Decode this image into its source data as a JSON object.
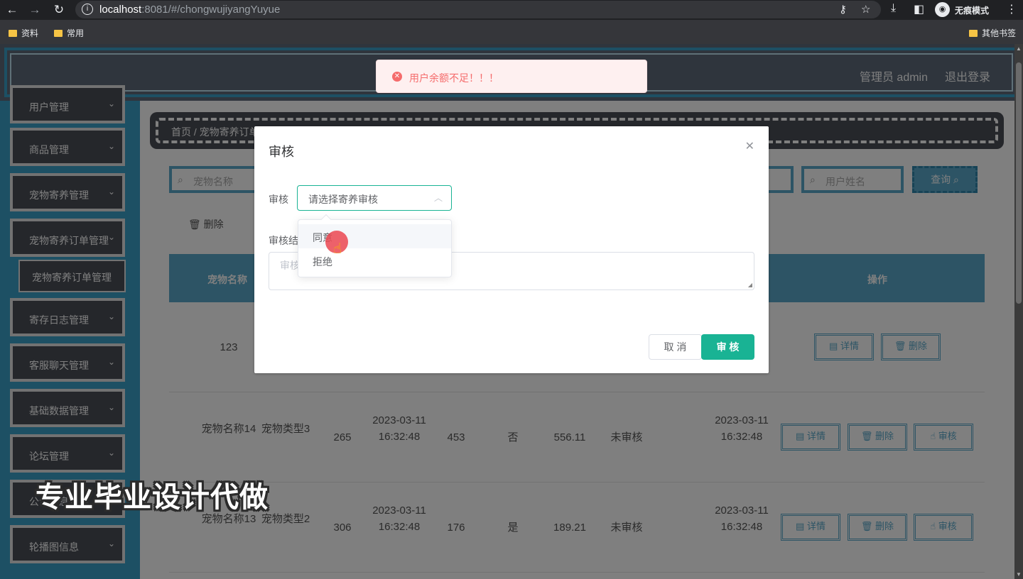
{
  "browser": {
    "url_host": "localhost",
    "url_rest": ":8081/#/chongwujiyangYuyue",
    "incognito_label": "无痕模式",
    "bookmarks": [
      "资料",
      "常用"
    ],
    "other_bookmarks": "其他书签"
  },
  "header": {
    "user_label": "管理员 admin",
    "logout_label": "退出登录"
  },
  "sidebar": {
    "items": [
      {
        "label": "用户管理"
      },
      {
        "label": "商品管理"
      },
      {
        "label": "宠物寄养管理"
      },
      {
        "label": "宠物寄养订单管理"
      },
      {
        "label": "寄存日志管理"
      },
      {
        "label": "客服聊天管理"
      },
      {
        "label": "基础数据管理"
      },
      {
        "label": "论坛管理"
      },
      {
        "label": "公告信息管理"
      },
      {
        "label": "轮播图信息"
      }
    ],
    "sub_item": "宠物寄养订单管理"
  },
  "breadcrumb": {
    "home": "首页",
    "separator": "/",
    "current": "宠物寄养订单管理"
  },
  "search": {
    "pet_name_placeholder": "宠物名称",
    "user_name_placeholder": "用户姓名",
    "query_label": "查询"
  },
  "toolbar": {
    "delete_label": "删除"
  },
  "table": {
    "headers": {
      "pet_name": "宠物名称",
      "actions": "操作"
    },
    "rows": [
      {
        "pet_name": "123",
        "actions": [
          "详情",
          "删除"
        ]
      },
      {
        "pet_name": "宠物名称14",
        "pet_type": "宠物类型3",
        "c3": "265",
        "time1": "2023-03-11 16:32:48",
        "c5": "453",
        "c6": "否",
        "price": "556.11",
        "status": "未审核",
        "time2": "2023-03-11 16:32:48",
        "actions": [
          "详情",
          "删除",
          "审核"
        ]
      },
      {
        "pet_name": "宠物名称13",
        "pet_type": "宠物类型2",
        "c3": "306",
        "time1": "2023-03-11 16:32:48",
        "c5": "176",
        "c6": "是",
        "price": "189.21",
        "status": "未审核",
        "time2": "2023-03-11 16:32:48",
        "actions": [
          "详情",
          "删除",
          "审核"
        ]
      }
    ]
  },
  "toast": {
    "message": "用户余额不足！！！",
    "color": "#f56c6c"
  },
  "dialog": {
    "title": "审核",
    "select_label": "审核",
    "select_placeholder": "请选择寄养审核",
    "result_label": "审核结果",
    "result_placeholder": "审核结果",
    "cancel_label": "取 消",
    "confirm_label": "审 核",
    "accent_color": "#19b394"
  },
  "dropdown": {
    "options": [
      "同意",
      "拒绝"
    ],
    "hovered": "同意"
  },
  "watermark": "专业毕业设计代做"
}
